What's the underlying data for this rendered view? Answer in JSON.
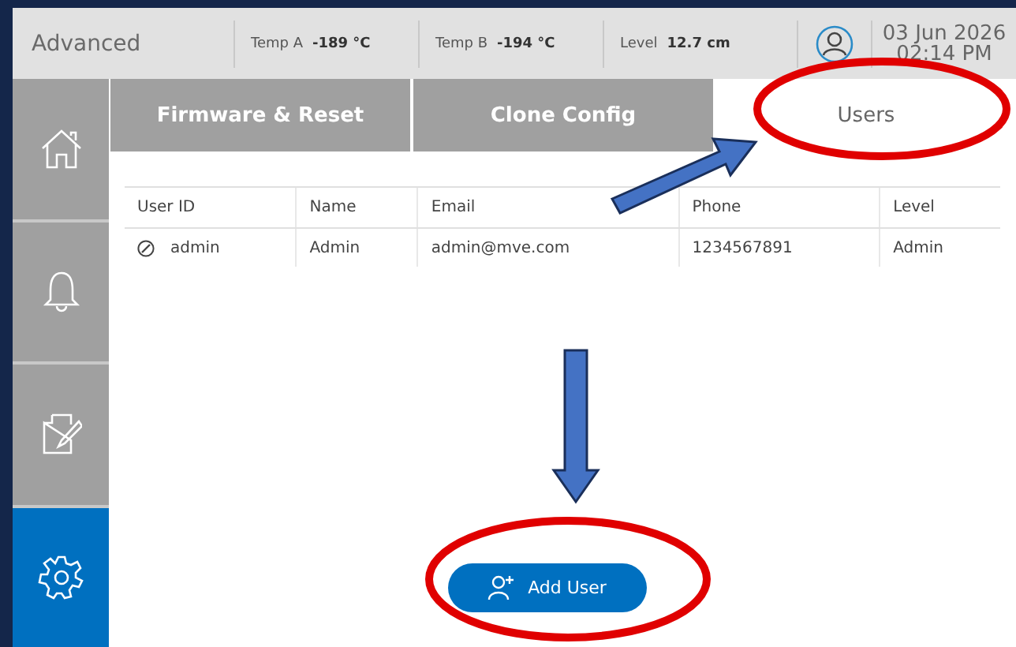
{
  "header": {
    "title": "Advanced",
    "readings": [
      {
        "label": "Temp A",
        "value": "-189 °C"
      },
      {
        "label": "Temp B",
        "value": "-194 °C"
      },
      {
        "label": "Level",
        "value": "12.7 cm"
      }
    ],
    "date": "03 Jun 2026",
    "time": "02:14 PM"
  },
  "sidebar": {
    "items": [
      {
        "kind": "home",
        "selected": false
      },
      {
        "kind": "bell",
        "selected": false
      },
      {
        "kind": "edit",
        "selected": false
      },
      {
        "kind": "gear",
        "selected": true
      }
    ]
  },
  "tabs": [
    {
      "label": "Firmware & Reset",
      "selected": false
    },
    {
      "label": "Clone Config",
      "selected": false
    },
    {
      "label": "Users",
      "selected": true
    }
  ],
  "table": {
    "columns": [
      "User ID",
      "Name",
      "Email",
      "Phone",
      "Level"
    ],
    "rows": [
      [
        "admin",
        "Admin",
        "admin@mve.com",
        "1234567891",
        "Admin"
      ]
    ]
  },
  "add_button": {
    "label": "Add User"
  }
}
